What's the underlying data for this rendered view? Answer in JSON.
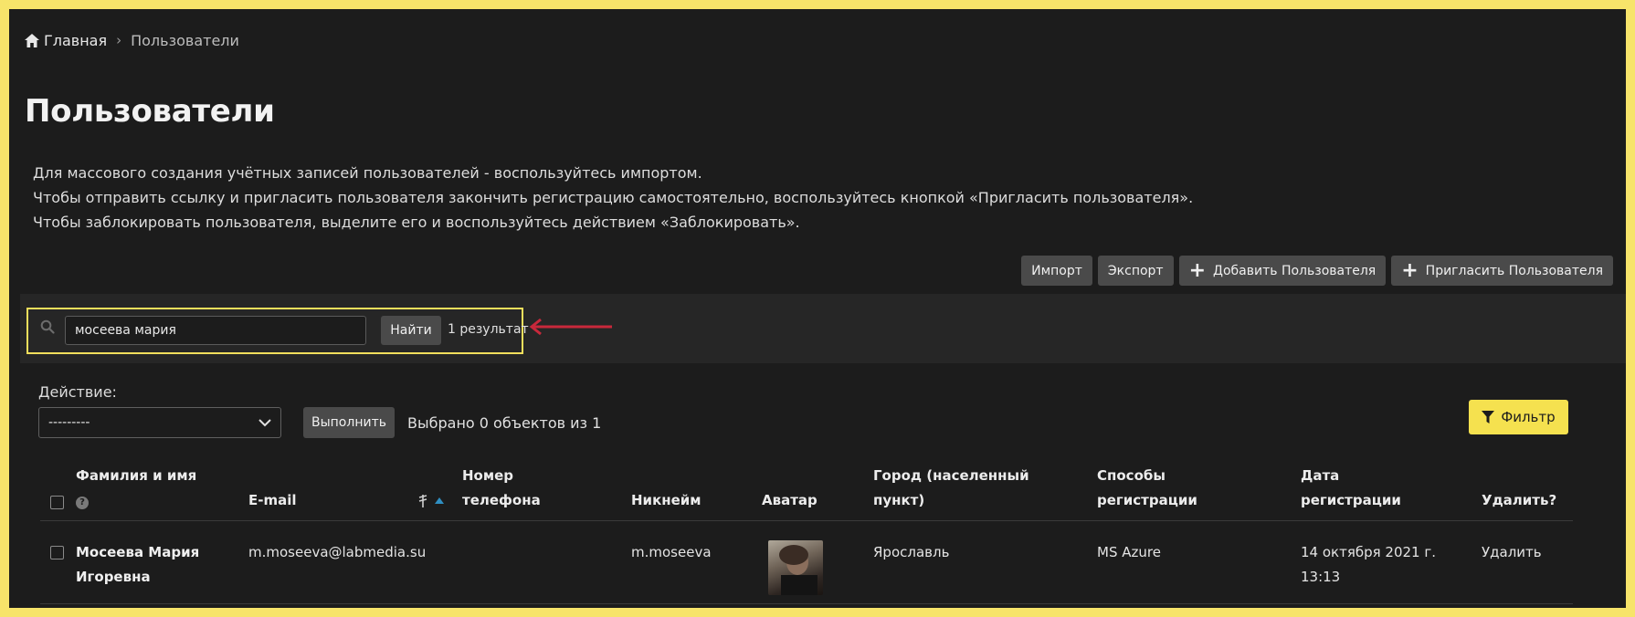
{
  "breadcrumb": {
    "home": "Главная",
    "separator": "›",
    "current": "Пользователи"
  },
  "page_title": "Пользователи",
  "help_lines": [
    "Для массового создания учётных записей пользователей - воспользуйтесь импортом.",
    "Чтобы отправить ссылку и пригласить пользователя закончить регистрацию самостоятельно, воспользуйтесь кнопкой «Пригласить пользователя».",
    "Чтобы заблокировать пользователя, выделите его и воспользуйтесь действием «Заблокировать»."
  ],
  "toolbar": {
    "import_label": "Импорт",
    "export_label": "Экспорт",
    "add_user_label": "Добавить Пользователя",
    "invite_user_label": "Пригласить Пользователя"
  },
  "search": {
    "value": "мосеева мария",
    "button_label": "Найти",
    "result_count": "1 результат"
  },
  "actions": {
    "label": "Действие:",
    "select_value": "---------",
    "run_label": "Выполнить",
    "selected_info": "Выбрано 0 объектов из 1",
    "filter_label": "Фильтр"
  },
  "table": {
    "headers": {
      "name": [
        "Фамилия и имя"
      ],
      "email": [
        "E-mail"
      ],
      "phone": [
        "Номер",
        "телефона"
      ],
      "nickname": [
        "Никнейм"
      ],
      "avatar": [
        "Аватар"
      ],
      "city": [
        "Город (населенный",
        "пункт)"
      ],
      "methods": [
        "Способы",
        "регистрации"
      ],
      "date": [
        "Дата",
        "регистрации"
      ],
      "delete": [
        "Удалить?"
      ]
    },
    "rows": [
      {
        "name": [
          "Мосеева Мария",
          "Игоревна"
        ],
        "email": "m.moseeva@labmedia.su",
        "phone": "",
        "nickname": "m.moseeva",
        "city": "Ярославль",
        "method": "MS Azure",
        "date": [
          "14 октября 2021 г.",
          "13:13"
        ],
        "delete": "Удалить"
      }
    ]
  },
  "colors": {
    "background": "#1c1c1c",
    "accent_yellow": "#f5e14f",
    "arrow_red": "#c8283b",
    "button_gray": "#4a4a4a"
  }
}
